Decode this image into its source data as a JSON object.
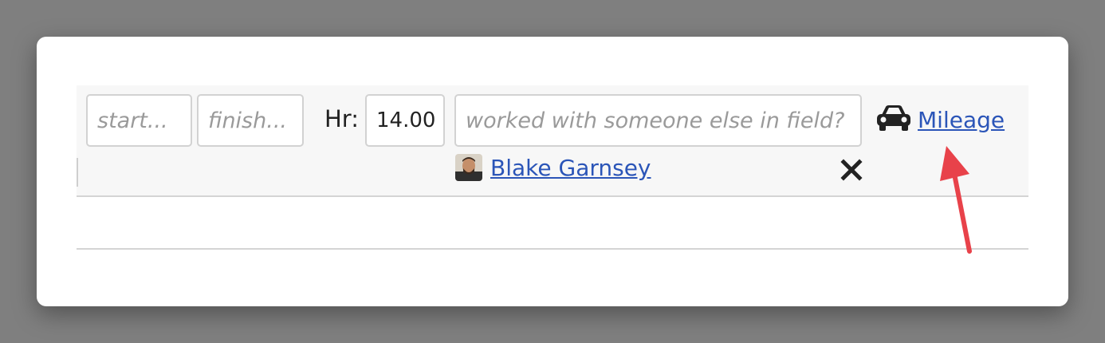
{
  "fields": {
    "start_placeholder": "start...",
    "finish_placeholder": "finish...",
    "hours_label": "Hr:",
    "hours_value": "14.00",
    "coworker_placeholder": "worked with someone else in field?"
  },
  "assigned_user": {
    "name": "Blake Garnsey"
  },
  "mileage": {
    "label": "Mileage",
    "icon": "car-icon"
  },
  "annotation": {
    "icon": "arrow-annotation",
    "color": "#e8424a"
  },
  "colors": {
    "link": "#2b55b8",
    "row_bg": "#f7f7f7",
    "border": "#d2d2d2"
  }
}
